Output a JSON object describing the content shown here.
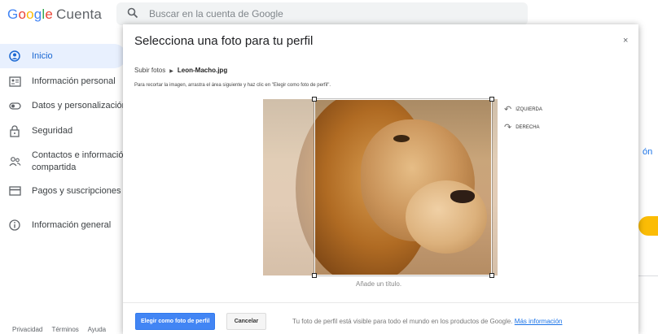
{
  "header": {
    "logo_google": [
      "G",
      "o",
      "o",
      "g",
      "l",
      "e"
    ],
    "logo_cuenta": "Cuenta",
    "search_placeholder": "Buscar en la cuenta de Google"
  },
  "sidebar": {
    "items": [
      {
        "label": "Inicio",
        "icon": "home-icon",
        "active": true
      },
      {
        "label": "Información personal",
        "icon": "id-card-icon"
      },
      {
        "label": "Datos y personalización",
        "icon": "toggle-icon"
      },
      {
        "label": "Seguridad",
        "icon": "lock-icon"
      },
      {
        "label": "Contactos e información",
        "label2": "compartida",
        "icon": "people-icon"
      },
      {
        "label": "Pagos y suscripciones",
        "icon": "credit-card-icon"
      },
      {
        "label": "Información general",
        "icon": "info-icon"
      }
    ]
  },
  "footer": {
    "privacy": "Privacidad",
    "terms": "Términos",
    "help": "Ayuda"
  },
  "background": {
    "peek_text": "ón"
  },
  "dialog": {
    "title": "Selecciona una foto para tu perfil",
    "close": "×",
    "breadcrumb_root": "Subir fotos",
    "breadcrumb_file": "Leon-Macho.jpg",
    "instructions": "Para recortar la imagen, arrastra el área siguiente y haz clic en \"Elegir como foto de perfil\".",
    "rotate_left": "IZQUIERDA",
    "rotate_right": "DERECHA",
    "caption": "Añade un título.",
    "primary_button": "Elegir como foto de perfil",
    "cancel_button": "Cancelar",
    "footer_note": "Tu foto de perfil está visible para todo el mundo en los productos de Google.",
    "footer_link": "Más información"
  },
  "colors": {
    "accent": "#4285f4",
    "active_bg": "#e8f0fe",
    "link": "#1a73e8"
  }
}
